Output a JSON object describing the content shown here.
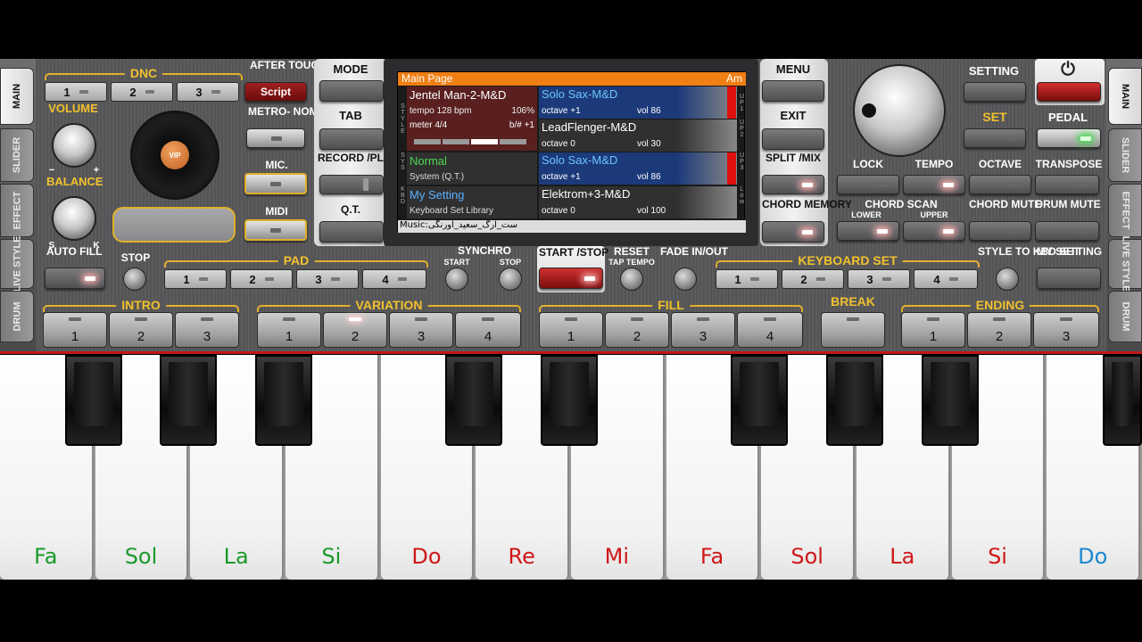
{
  "side_tabs_left": [
    "MAIN",
    "SLIDER",
    "EFFECT",
    "LIVE STYLE",
    "DRUM"
  ],
  "side_tabs_right": [
    "MAIN",
    "SLIDER",
    "EFFECT",
    "LIVE STYLE",
    "DRUM"
  ],
  "dnc": {
    "label": "DNC",
    "buttons": [
      "1",
      "2",
      "3"
    ],
    "script": "Script"
  },
  "labels": {
    "aftertouch": "AFTER TOUCH",
    "volume": "VOLUME",
    "balance": "BALANCE",
    "metronome": "METRO- NOME",
    "mic": "MIC.",
    "midi": "MIDI",
    "auto_fill": "AUTO FILL",
    "stop": "STOP",
    "pad": "PAD",
    "synchro": "SYNCHRO",
    "synchro_start": "START",
    "synchro_stop": "STOP",
    "start_stop": "START /STOP",
    "reset": "RESET",
    "tap_tempo": "TAP TEMPO",
    "fade": "FADE IN/OUT",
    "keyboard_set": "KEYBOARD SET",
    "style_to_kbd": "STYLE TO KBD SET",
    "my_setting": "MY SETTING",
    "intro": "INTRO",
    "variation": "VARIATION",
    "fill": "FILL",
    "break": "BREAK",
    "ending": "ENDING",
    "mode": "MODE",
    "tab": "TAB",
    "record_play": "RECORD /PLAY",
    "qt": "Q.T.",
    "menu": "MENU",
    "exit": "EXIT",
    "split_mix": "SPLIT /MIX",
    "chord_memory": "CHORD MEMORY",
    "setting": "SETTING",
    "set": "SET",
    "pedal": "PEDAL",
    "lock": "LOCK",
    "tempo": "TEMPO",
    "octave": "OCTAVE",
    "transpose": "TRANSPOSE",
    "chord_scan": "CHORD SCAN",
    "lower": "LOWER",
    "upper": "UPPER",
    "chord_mute": "CHORD MUTE",
    "drum_mute": "DRUM MUTE",
    "knob_minus": "−",
    "knob_plus": "+",
    "bal_s": "S",
    "bal_k": "K",
    "vip": "VIP"
  },
  "pad_buttons": [
    "1",
    "2",
    "3",
    "4"
  ],
  "kbd_buttons": [
    "1",
    "2",
    "3",
    "4"
  ],
  "intro": [
    "1",
    "2",
    "3"
  ],
  "variation": [
    "1",
    "2",
    "3",
    "4"
  ],
  "fill": [
    "1",
    "2",
    "3",
    "4"
  ],
  "ending": [
    "1",
    "2",
    "3"
  ],
  "screen": {
    "header": "Main Page",
    "key": "Am",
    "style_name": "Jentel Man-2-M&D",
    "tempo": "tempo 128 bpm",
    "tempo_pct": "106%",
    "meter": "meter 4/4",
    "bsharp": "b/# +1",
    "sys_name": "Normal",
    "sys_sub": "System (Q.T.)",
    "kbd_name": "My Setting",
    "kbd_sub": "Keyboard Set Library",
    "up1": {
      "name": "Solo Sax-M&D",
      "octave": "octave +1",
      "vol": "vol 86"
    },
    "up2": {
      "name": "LeadFlenger-M&D",
      "octave": "octave  0",
      "vol": "vol 30"
    },
    "up3": {
      "name": "Solo Sax-M&D",
      "octave": "octave +1",
      "vol": "vol 86"
    },
    "low": {
      "name": "Elektrom+3-M&D",
      "octave": "octave  0",
      "vol": "vol 100"
    },
    "side_up1": "UP1",
    "side_up2": "UP2",
    "side_up3": "UP3",
    "side_low": "Low",
    "style_side": "STYLE",
    "sys_side": "SYS",
    "kbd_side": "KBD",
    "footer": "Music:ست_ارگ_سعید_اورنگی"
  },
  "keys": [
    {
      "label": "Fa",
      "color": "#1a9a2a"
    },
    {
      "label": "Sol",
      "color": "#1a9a2a"
    },
    {
      "label": "La",
      "color": "#1a9a2a"
    },
    {
      "label": "Si",
      "color": "#1a9a2a"
    },
    {
      "label": "Do",
      "color": "#d01818"
    },
    {
      "label": "Re",
      "color": "#d01818"
    },
    {
      "label": "Mi",
      "color": "#d01818"
    },
    {
      "label": "Fa",
      "color": "#d01818"
    },
    {
      "label": "Sol",
      "color": "#d01818"
    },
    {
      "label": "La",
      "color": "#d01818"
    },
    {
      "label": "Si",
      "color": "#d01818"
    },
    {
      "label": "Do",
      "color": "#1a8ad0"
    }
  ]
}
